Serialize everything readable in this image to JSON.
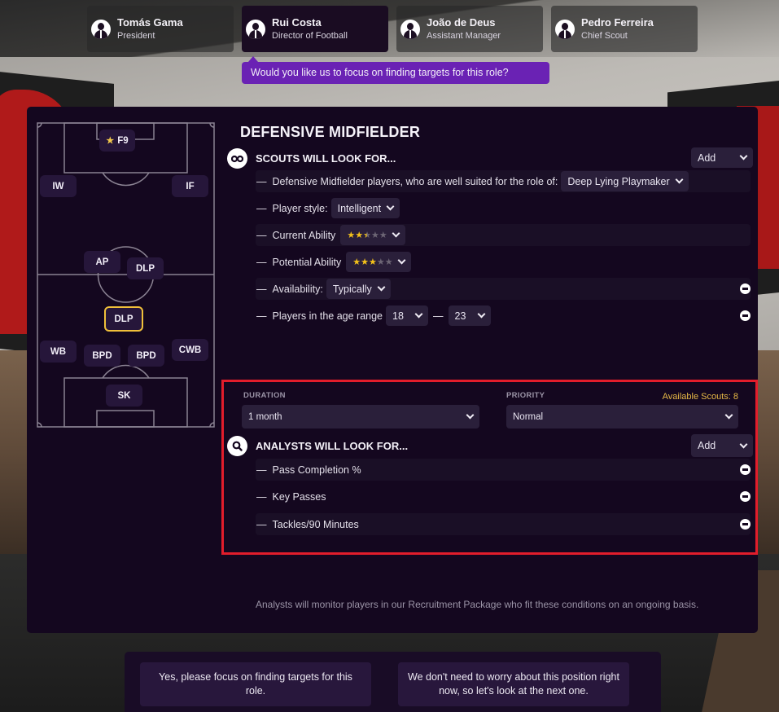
{
  "staff": [
    {
      "name": "Tomás Gama",
      "role": "President",
      "active": false
    },
    {
      "name": "Rui Costa",
      "role": "Director of Football",
      "active": true
    },
    {
      "name": "João de Deus",
      "role": "Assistant Manager",
      "active": false
    },
    {
      "name": "Pedro Ferreira",
      "role": "Chief Scout",
      "active": false
    }
  ],
  "bubble": "Would you like us to focus on finding targets for this role?",
  "pitch": {
    "positions": {
      "f9": "F9",
      "iw": "IW",
      "if": "IF",
      "ap": "AP",
      "dlp_am": "DLP",
      "dlp_dm": "DLP",
      "wb": "WB",
      "bpd_l": "BPD",
      "bpd_r": "BPD",
      "cwb": "CWB",
      "sk": "SK"
    },
    "selected": "DLP",
    "starred": "F9"
  },
  "title": "DEFENSIVE MIDFIELDER",
  "scouts": {
    "heading": "SCOUTS WILL LOOK FOR...",
    "add_label": "Add",
    "role_text": "Defensive Midfielder players, who are well suited for the role of:",
    "role_value": "Deep Lying Playmaker",
    "style_label": "Player style:",
    "style_value": "Intelligent",
    "ca_label": "Current Ability",
    "ca_stars": 2.5,
    "pa_label": "Potential Ability",
    "pa_stars": 3,
    "availability_label": "Availability:",
    "availability_value": "Typically",
    "age_label": "Players in the age range",
    "age_min": "18",
    "age_max": "23",
    "age_sep": "—"
  },
  "settings": {
    "duration_label": "DURATION",
    "duration_value": "1 month",
    "priority_label": "PRIORITY",
    "priority_value": "Normal",
    "available_scouts": "Available Scouts: 8"
  },
  "analysts": {
    "heading": "ANALYSTS WILL LOOK FOR...",
    "add_label": "Add",
    "items": [
      "Pass Completion %",
      "Key Passes",
      "Tackles/90 Minutes"
    ]
  },
  "footnote": "Analysts will monitor players in our Recruitment Package who fit these conditions on an ongoing basis.",
  "answers": {
    "yes": "Yes, please focus on finding targets for this role.",
    "no": "We don't need to worry about this position right now, so let's look at the next one."
  },
  "dash": "—",
  "colors": {
    "accent_purple": "#6a22b4",
    "panel": "#14071f",
    "highlight_red": "#e21d2b",
    "star_gold": "#f4c21a",
    "scouts_gold": "#e7b946"
  }
}
